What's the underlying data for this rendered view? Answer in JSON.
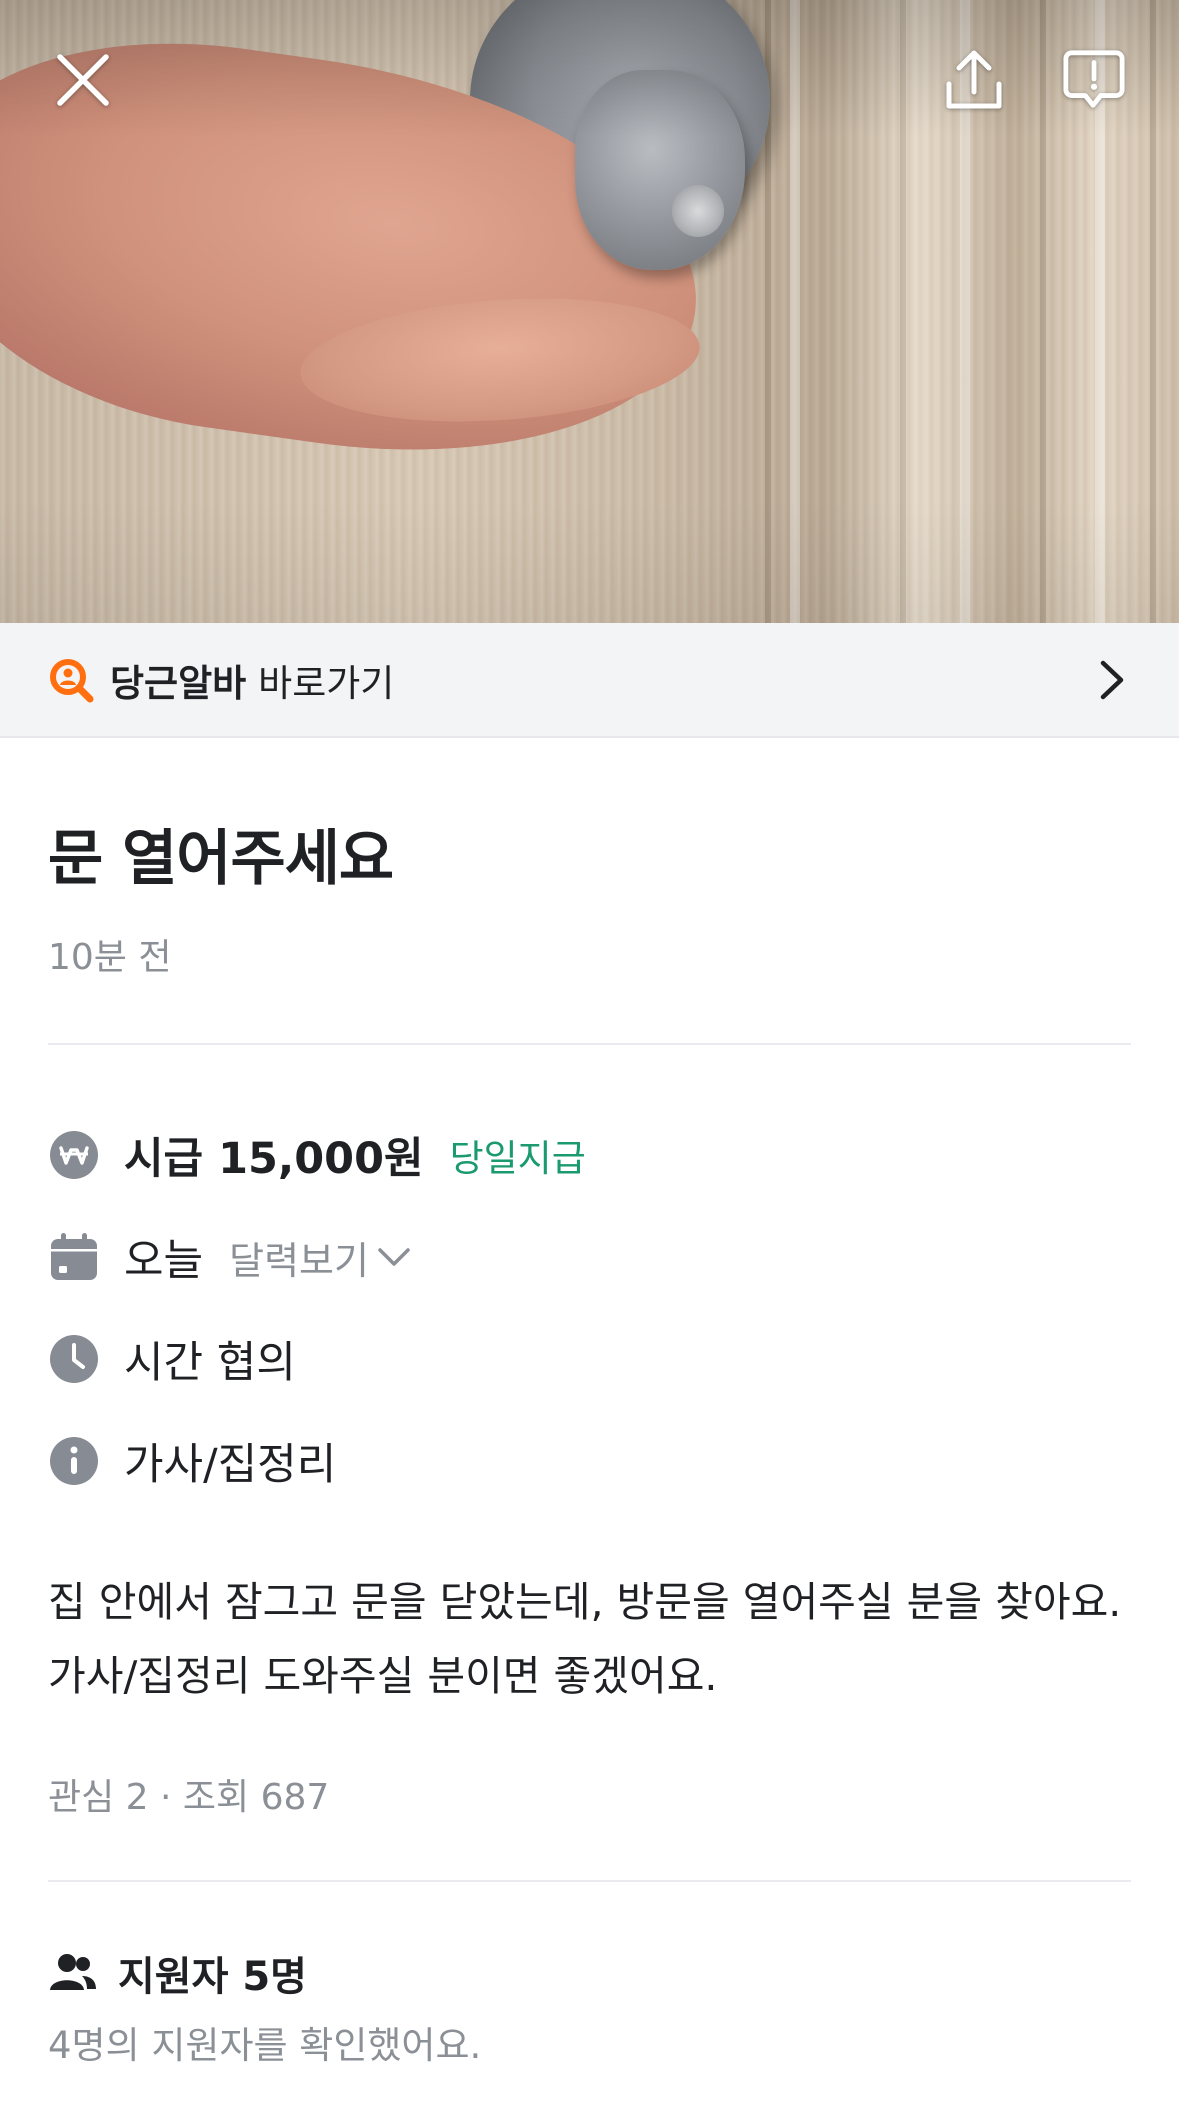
{
  "header": {
    "close_icon": "close-icon",
    "share_icon": "share-icon",
    "report_icon": "report-icon"
  },
  "shortcut": {
    "brand": "당근알바",
    "label": "바로가기",
    "icon": "magnifier-person-icon",
    "accent": "#ff6f0f"
  },
  "post": {
    "title": "문 열어주세요",
    "time_ago": "10분 전"
  },
  "details": {
    "wage": "시급 15,000원",
    "payday": "당일지급",
    "date": "오늘",
    "calendar_link": "달력보기",
    "hours": "시간 협의",
    "category": "가사/집정리"
  },
  "description": "집 안에서 잠그고 문을 닫았는데, 방문을 열어주실 분을 찾아요. 가사/집정리 도와주실 분이면 좋겠어요.",
  "stats": "관심 2 · 조회 687",
  "applicants": {
    "title": "지원자 5명",
    "subtitle": "4명의 지원자를 확인했어요."
  },
  "colors": {
    "pay_green": "#1a9a6e",
    "muted_text": "#8b8f96",
    "icon_gray": "#868b94"
  }
}
